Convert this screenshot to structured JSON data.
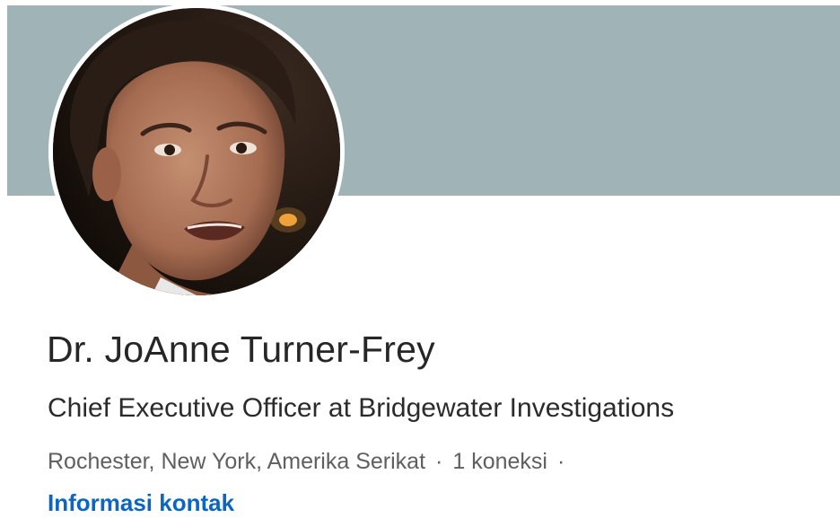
{
  "profile": {
    "name": "Dr. JoAnne Turner-Frey",
    "headline": "Chief Executive Officer at Bridgewater Investigations",
    "location": "Rochester, New York, Amerika Serikat",
    "separator": "·",
    "connections": "1 koneksi",
    "contact_link": "Informasi kontak"
  },
  "colors": {
    "banner": "#a0b4b7",
    "link": "#0a66c2",
    "name_text": "#262626",
    "meta_text": "#5f5f5f"
  }
}
